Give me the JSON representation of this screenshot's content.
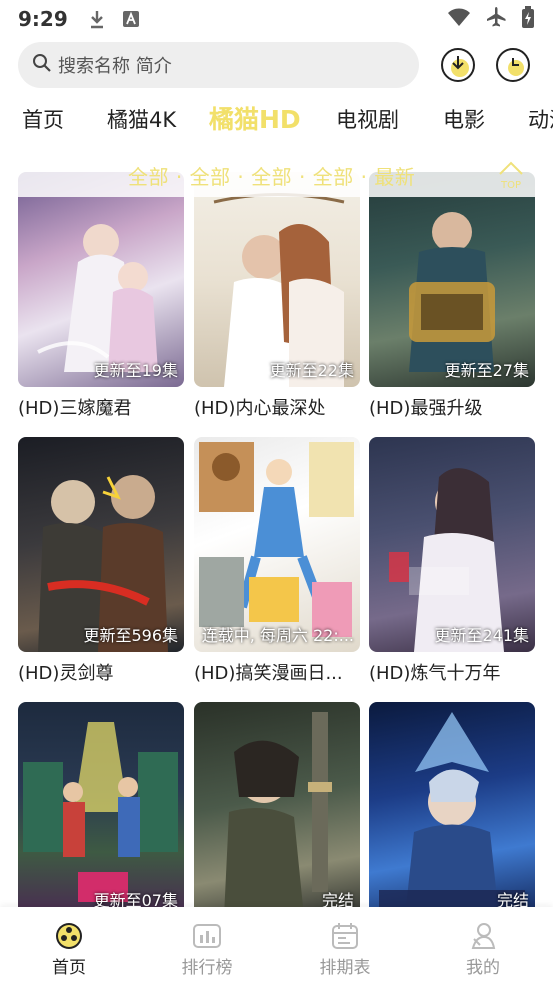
{
  "status": {
    "time": "9:29"
  },
  "search": {
    "placeholder": "搜索名称 简介"
  },
  "tabs": [
    {
      "label": "首页"
    },
    {
      "label": "橘猫4K"
    },
    {
      "label": "橘猫HD"
    },
    {
      "label": "电视剧"
    },
    {
      "label": "电影"
    },
    {
      "label": "动漫"
    }
  ],
  "filter": {
    "text": "全部 · 全部 · 全部 · 全部 · 最新",
    "top_label": "TOP"
  },
  "cards": [
    {
      "badge": "更新至19集",
      "title": "(HD)三嫁魔君"
    },
    {
      "badge": "更新至22集",
      "title": "(HD)内心最深处"
    },
    {
      "badge": "更新至27集",
      "title": "(HD)最强升级"
    },
    {
      "badge": "更新至596集",
      "title": "(HD)灵剑尊"
    },
    {
      "badge": "连载中, 每周六 22:...",
      "title": "(HD)搞笑漫画日..."
    },
    {
      "badge": "更新至241集",
      "title": "(HD)炼气十万年"
    },
    {
      "badge": "更新至07集",
      "title": ""
    },
    {
      "badge": "完结",
      "title": ""
    },
    {
      "badge": "完结",
      "title": ""
    }
  ],
  "nav": [
    {
      "label": "首页"
    },
    {
      "label": "排行榜"
    },
    {
      "label": "排期表"
    },
    {
      "label": "我的"
    }
  ],
  "colors": {
    "accent": "#f2e06a",
    "text": "#222222",
    "inactive": "#999999"
  }
}
